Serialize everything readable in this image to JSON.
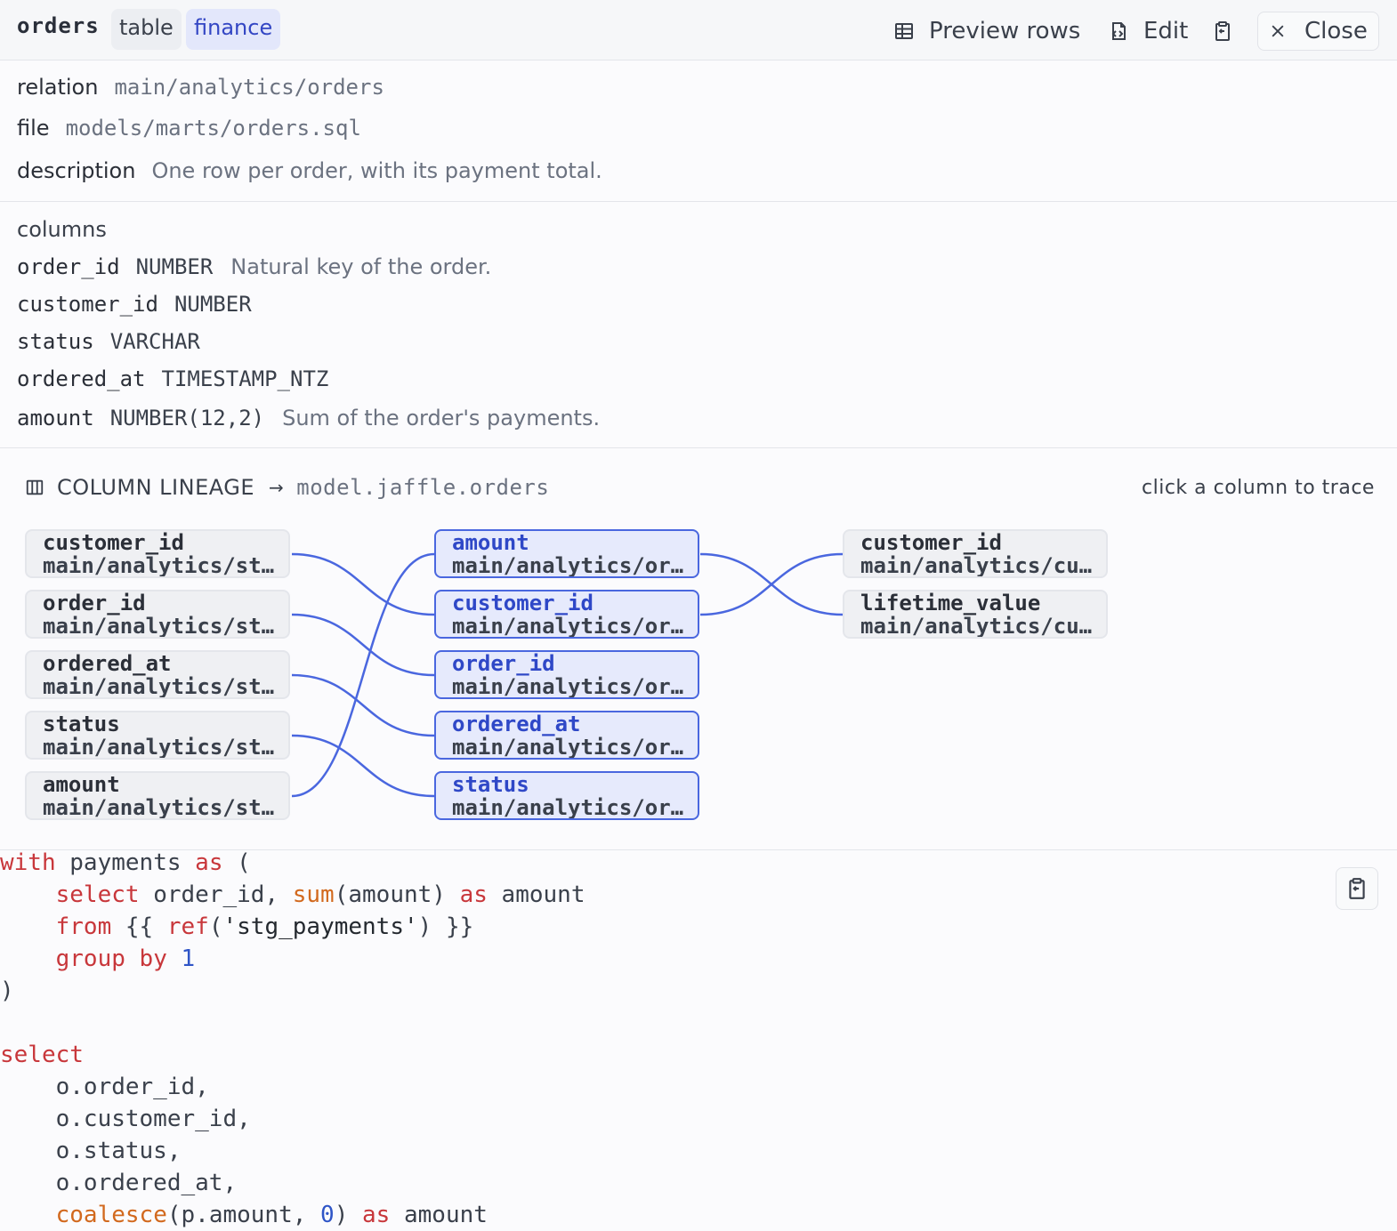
{
  "header": {
    "title": "orders",
    "type_tag": "table",
    "group_tag": "finance",
    "preview_label": "Preview rows",
    "edit_label": "Edit",
    "close_label": "Close"
  },
  "meta": {
    "relation_key": "relation",
    "relation_value": "main/analytics/orders",
    "file_key": "file",
    "file_value": "models/marts/orders.sql",
    "description_key": "description",
    "description_value": "One row per order, with its payment total."
  },
  "columns": {
    "heading": "columns",
    "items": [
      {
        "name": "order_id",
        "type": "NUMBER",
        "description": "Natural key of the order."
      },
      {
        "name": "customer_id",
        "type": "NUMBER",
        "description": ""
      },
      {
        "name": "status",
        "type": "VARCHAR",
        "description": ""
      },
      {
        "name": "ordered_at",
        "type": "TIMESTAMP_NTZ",
        "description": ""
      },
      {
        "name": "amount",
        "type": "NUMBER(12,2)",
        "description": "Sum of the order's payments."
      }
    ]
  },
  "lineage": {
    "heading": "COLUMN LINEAGE",
    "arrow": "→",
    "model": "model.jaffle.orders",
    "hint": "click a column to trace",
    "upstream": [
      {
        "name": "customer_id",
        "relation": "main/analytics/stg_orders"
      },
      {
        "name": "order_id",
        "relation": "main/analytics/stg_orders"
      },
      {
        "name": "ordered_at",
        "relation": "main/analytics/stg_orders"
      },
      {
        "name": "status",
        "relation": "main/analytics/stg_orders"
      },
      {
        "name": "amount",
        "relation": "main/analytics/stg_payments"
      }
    ],
    "current": [
      {
        "name": "amount",
        "relation": "main/analytics/orders"
      },
      {
        "name": "customer_id",
        "relation": "main/analytics/orders"
      },
      {
        "name": "order_id",
        "relation": "main/analytics/orders"
      },
      {
        "name": "ordered_at",
        "relation": "main/analytics/orders"
      },
      {
        "name": "status",
        "relation": "main/analytics/orders"
      }
    ],
    "downstream": [
      {
        "name": "customer_id",
        "relation": "main/analytics/customers"
      },
      {
        "name": "lifetime_value",
        "relation": "main/analytics/customers"
      }
    ]
  },
  "code": {
    "lines": [
      [
        {
          "t": "with",
          "c": "kw"
        },
        {
          "t": " payments ",
          "c": ""
        },
        {
          "t": "as",
          "c": "kw"
        },
        {
          "t": " (",
          "c": ""
        }
      ],
      [
        {
          "t": "    ",
          "c": ""
        },
        {
          "t": "select",
          "c": "kw"
        },
        {
          "t": " order_id, ",
          "c": ""
        },
        {
          "t": "sum",
          "c": "fn"
        },
        {
          "t": "(amount) ",
          "c": ""
        },
        {
          "t": "as",
          "c": "kw"
        },
        {
          "t": " amount",
          "c": ""
        }
      ],
      [
        {
          "t": "    ",
          "c": ""
        },
        {
          "t": "from",
          "c": "kw"
        },
        {
          "t": " {{ ",
          "c": ""
        },
        {
          "t": "ref",
          "c": "kw"
        },
        {
          "t": "(",
          "c": ""
        },
        {
          "t": "'stg_payments'",
          "c": "str"
        },
        {
          "t": ") }}",
          "c": ""
        }
      ],
      [
        {
          "t": "    ",
          "c": ""
        },
        {
          "t": "group by",
          "c": "kw"
        },
        {
          "t": " ",
          "c": ""
        },
        {
          "t": "1",
          "c": "num"
        }
      ],
      [
        {
          "t": ")",
          "c": ""
        }
      ],
      [
        {
          "t": "",
          "c": ""
        }
      ],
      [
        {
          "t": "select",
          "c": "kw"
        }
      ],
      [
        {
          "t": "    o.order_id,",
          "c": ""
        }
      ],
      [
        {
          "t": "    o.customer_id,",
          "c": ""
        }
      ],
      [
        {
          "t": "    o.status,",
          "c": ""
        }
      ],
      [
        {
          "t": "    o.ordered_at,",
          "c": ""
        }
      ],
      [
        {
          "t": "    ",
          "c": ""
        },
        {
          "t": "coalesce",
          "c": "fn"
        },
        {
          "t": "(p.amount, ",
          "c": ""
        },
        {
          "t": "0",
          "c": "num"
        },
        {
          "t": ") ",
          "c": ""
        },
        {
          "t": "as",
          "c": "kw"
        },
        {
          "t": " amount",
          "c": ""
        }
      ]
    ]
  },
  "colors": {
    "accent": "#4a67df",
    "edge": "#4a67df",
    "keyword": "#c8373b",
    "function": "#d2691e",
    "number": "#2f55c7"
  },
  "icons": {
    "preview": "table-grid-icon",
    "edit": "file-edit-icon",
    "copy": "clipboard-icon",
    "close": "close-icon",
    "lineage": "columns-icon"
  }
}
